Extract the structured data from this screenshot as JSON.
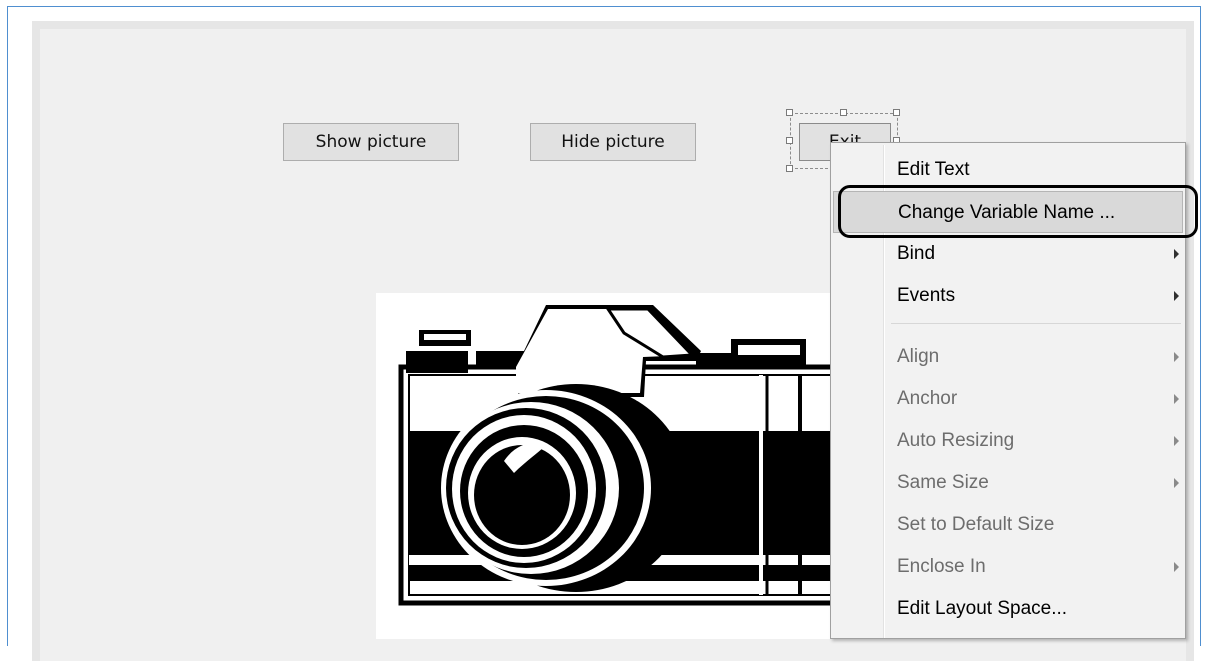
{
  "buttons": {
    "show_picture": "Show picture",
    "hide_picture": "Hide picture",
    "exit": "Exit"
  },
  "picture": {
    "icon": "camera-icon",
    "colors": [
      "#000000",
      "#ffffff"
    ]
  },
  "context_menu": {
    "items": [
      {
        "label": "Edit Text",
        "enabled": true,
        "submenu": false
      },
      {
        "label": "Change Variable Name ...",
        "enabled": true,
        "submenu": false,
        "highlighted": true
      },
      {
        "label": "Bind",
        "enabled": true,
        "submenu": true
      },
      {
        "label": "Events",
        "enabled": true,
        "submenu": true
      },
      {
        "label": "Align",
        "enabled": false,
        "submenu": true
      },
      {
        "label": "Anchor",
        "enabled": false,
        "submenu": true
      },
      {
        "label": "Auto Resizing",
        "enabled": false,
        "submenu": true
      },
      {
        "label": "Same Size",
        "enabled": false,
        "submenu": true
      },
      {
        "label": "Set to Default Size",
        "enabled": false,
        "submenu": false
      },
      {
        "label": "Enclose In",
        "enabled": false,
        "submenu": true
      },
      {
        "label": "Edit Layout Space...",
        "enabled": true,
        "submenu": false
      }
    ]
  },
  "colors": {
    "window_border": "#4f8fd0",
    "canvas_bg": "#f0f0f0",
    "menu_bg": "#f2f2f2",
    "menu_highlight": "#d9d9d9",
    "disabled_text": "#6d6d6d"
  }
}
